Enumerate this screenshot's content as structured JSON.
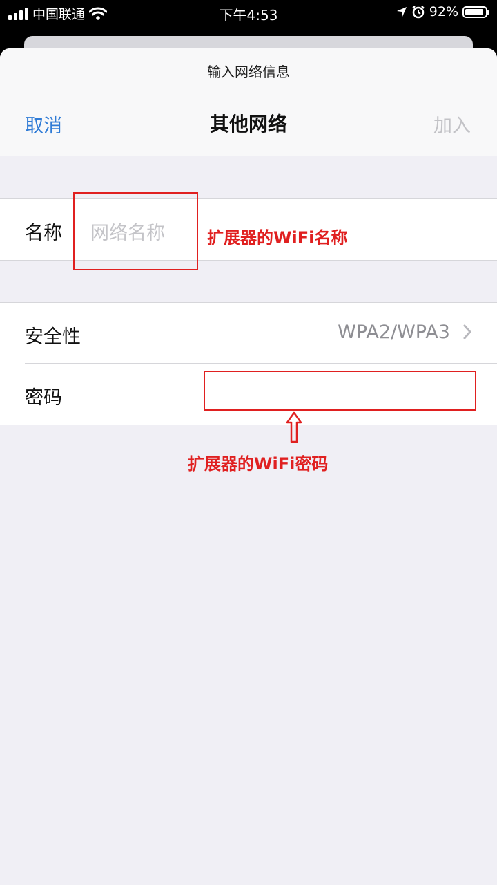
{
  "status_bar": {
    "carrier": "中国联通",
    "time": "下午4:53",
    "battery": "92%",
    "battery_level": 0.92
  },
  "sheet": {
    "prompt": "输入网络信息",
    "cancel_label": "取消",
    "title": "其他网络",
    "join_label": "加入"
  },
  "form": {
    "name_label": "名称",
    "name_placeholder": "网络名称",
    "security_label": "安全性",
    "security_value": "WPA2/WPA3",
    "password_label": "密码"
  },
  "annotations": {
    "name_note": "扩展器的WiFi名称",
    "password_note": "扩展器的WiFi密码",
    "color": "#e02020"
  },
  "colors": {
    "accent": "#2f7bd6",
    "disabled": "#c2c2c6",
    "background": "#f0eff5"
  },
  "icons": [
    "signal-icon",
    "wifi-icon",
    "location-icon",
    "alarm-icon",
    "battery-icon",
    "chevron-right-icon",
    "arrow-up-icon"
  ]
}
